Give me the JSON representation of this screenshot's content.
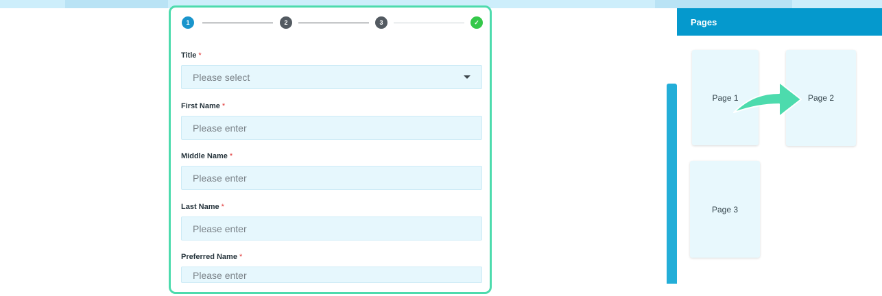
{
  "stepper": {
    "steps": [
      "1",
      "2",
      "3",
      "✓"
    ],
    "active_step": 1,
    "colors": {
      "active": "#1a95cc",
      "pending": "#535a61",
      "done": "#34c84a"
    }
  },
  "form": {
    "required_mark": "*",
    "title": {
      "label": "Title",
      "placeholder": "Please select"
    },
    "first_name": {
      "label": "First Name",
      "placeholder": "Please enter"
    },
    "middle_name": {
      "label": "Middle Name",
      "placeholder": "Please enter"
    },
    "last_name": {
      "label": "Last Name",
      "placeholder": "Please enter"
    },
    "preferred_name": {
      "label": "Preferred Name",
      "placeholder": "Please enter"
    }
  },
  "pages_panel": {
    "title": "Pages",
    "pages": [
      "Page 1",
      "Page 2",
      "Page 3"
    ],
    "header_color": "#0599cd",
    "arrow_color": "#4ddbad"
  }
}
